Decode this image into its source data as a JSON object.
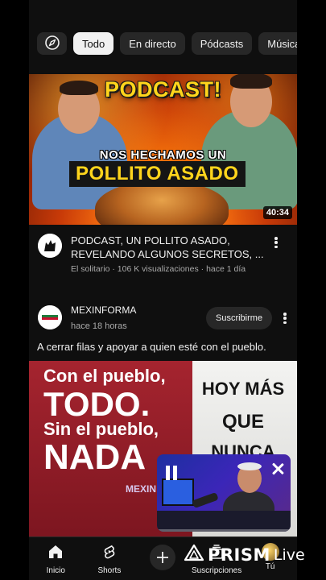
{
  "chips": {
    "explore_icon": "compass-icon",
    "items": [
      "Todo",
      "En directo",
      "Pódcasts",
      "Música"
    ]
  },
  "video1": {
    "thumbnail": {
      "headline_top": "PODCAST!",
      "headline_middle": "NOS HECHAMOS UN",
      "headline_bottom": "POLLITO ASADO",
      "duration": "40:34"
    },
    "title": "PODCAST, UN POLLITO ASADO, REVELANDO ALGUNOS SECRETOS, ...",
    "meta": "El solitario · 106 K visualizaciones · hace 1 día"
  },
  "post": {
    "channel": "MEXINFORMA",
    "time": "hace 18 horas",
    "subscribe_label": "Suscribirme",
    "text": "A cerrar filas y apoyar a quien esté con el pueblo.",
    "image": {
      "line1": "Con el pueblo,",
      "line2": "TODO.",
      "line3": "Sin el pueblo,",
      "line4": "NADA",
      "right1": "HOY MÁS",
      "right2": "QUE",
      "right3": "NUNCA",
      "brand": "MEXIN"
    }
  },
  "pip": {
    "state": "playing",
    "progress": 0.0
  },
  "bottom_nav": {
    "items": [
      {
        "label": "Inicio",
        "icon": "home-icon"
      },
      {
        "label": "Shorts",
        "icon": "shorts-icon"
      },
      {
        "label": "",
        "icon": "create-icon"
      },
      {
        "label": "Suscripciones",
        "icon": "subscriptions-icon"
      },
      {
        "label": "Tú",
        "icon": "you-avatar"
      }
    ]
  },
  "watermark": {
    "name": "PRISM",
    "suffix": "Live"
  },
  "colors": {
    "background": "#0f0f0f",
    "chip": "#272727",
    "chip_active": "#f1f1f1",
    "accent_red": "#ff0033",
    "secondary_text": "#aaaaaa"
  }
}
